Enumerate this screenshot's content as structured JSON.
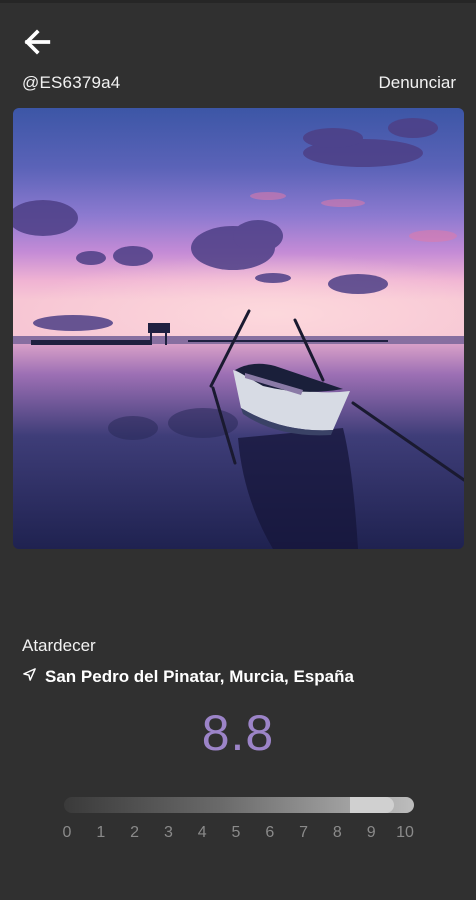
{
  "header": {
    "back_icon": "arrow-left-icon",
    "username": "@ES6379a4",
    "report_label": "Denunciar"
  },
  "photo": {
    "subject": "sunset-boat-photo"
  },
  "details": {
    "title": "Atardecer",
    "location_icon": "navigation-arrow-icon",
    "location": "San Pedro del Pinatar, Murcia, España"
  },
  "rating": {
    "score": "8.8",
    "score_color": "#9c84c8",
    "slider_value": 8.8,
    "slider_min": 0,
    "slider_max": 10,
    "ticks": [
      "0",
      "1",
      "2",
      "3",
      "4",
      "5",
      "6",
      "7",
      "8",
      "9",
      "10"
    ]
  }
}
